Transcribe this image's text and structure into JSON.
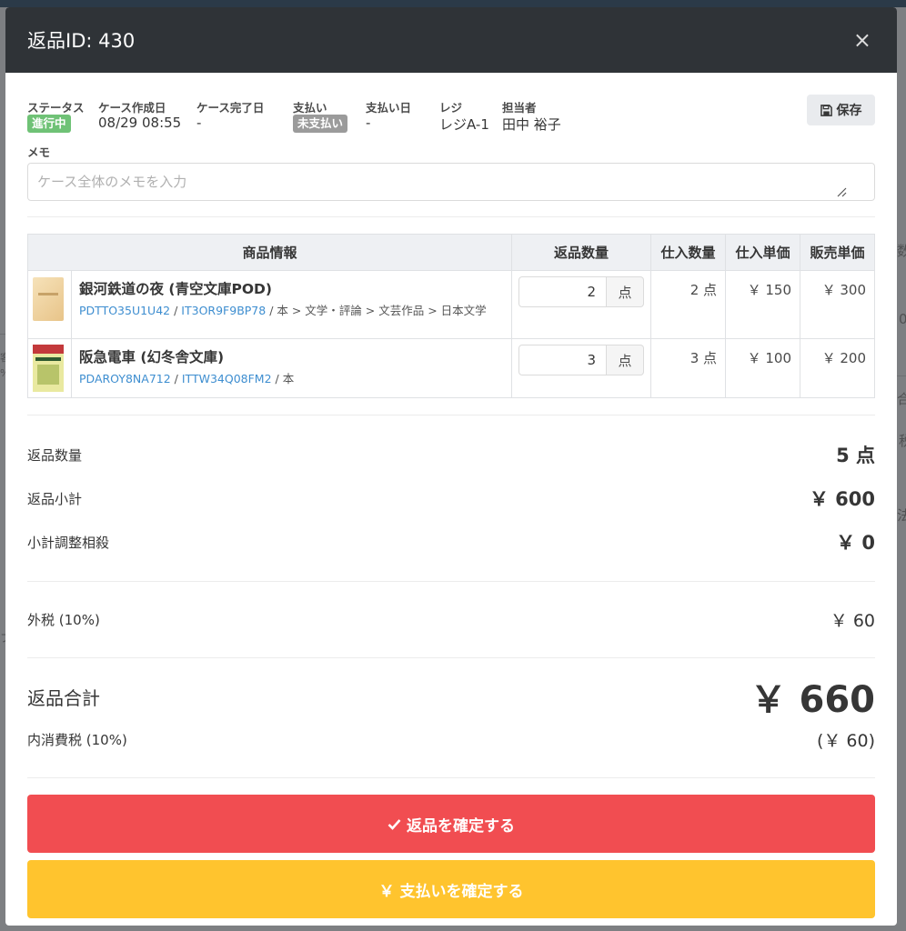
{
  "background": {
    "fragments": [
      "数",
      "0",
      "合",
      "税",
      "法",
      "客",
      "%",
      "フ"
    ]
  },
  "modal": {
    "title": "返品ID: 430",
    "close_glyph": "×"
  },
  "info": {
    "status": {
      "label": "ステータス",
      "value": "進行中"
    },
    "created": {
      "label": "ケース作成日",
      "value": "08/29 08:55"
    },
    "completed": {
      "label": "ケース完了日",
      "value": "-"
    },
    "payment": {
      "label": "支払い",
      "value": "未支払い"
    },
    "payment_date": {
      "label": "支払い日",
      "value": "-"
    },
    "register": {
      "label": "レジ",
      "value": "レジA-1"
    },
    "staff": {
      "label": "担当者",
      "value": "田中 裕子"
    },
    "save_label": "保存"
  },
  "memo": {
    "label": "メモ",
    "placeholder": "ケース全体のメモを入力",
    "value": ""
  },
  "table": {
    "headers": {
      "product": "商品情報",
      "return_qty": "返品数量",
      "purchase_qty": "仕入数量",
      "purchase_price": "仕入単価",
      "sale_price": "販売単価"
    },
    "rows": [
      {
        "title": "銀河鉄道の夜 (青空文庫POD)",
        "code1": "PDTTO35U1U42",
        "code2": "IT3OR9F9BP78",
        "category": " / 本 > 文学・評論 > 文芸作品 > 日本文学",
        "qty": "2",
        "unit": "点",
        "purchase_qty": "2 点",
        "purchase_price": "￥ 150",
        "sale_price": "￥ 300"
      },
      {
        "title": "阪急電車 (幻冬舎文庫)",
        "code1": "PDAROY8NA712",
        "code2": "ITTW34Q08FM2",
        "category": " / 本",
        "qty": "3",
        "unit": "点",
        "purchase_qty": "3 点",
        "purchase_price": "￥ 100",
        "sale_price": "￥ 200"
      }
    ]
  },
  "summary": {
    "return_qty": {
      "label": "返品数量",
      "value": "5 点"
    },
    "subtotal": {
      "label": "返品小計",
      "value": "￥ 600"
    },
    "adjustment": {
      "label": "小計調整相殺",
      "value": "￥ 0"
    },
    "tax": {
      "label": "外税 (10%)",
      "value": "￥ 60"
    },
    "total": {
      "label": "返品合計",
      "value": "￥ 660"
    },
    "inner_tax": {
      "label": "内消費税 (10%)",
      "value": "(￥ 60)"
    }
  },
  "actions": {
    "confirm_return": "返品を確定する",
    "confirm_payment": "支払いを確定する"
  },
  "colors": {
    "header_bg": "#2f3337",
    "status_green": "#6fc276",
    "payment_grey": "#9b9b9b",
    "link_blue": "#3e8ed0",
    "confirm_red": "#f14d51",
    "payment_yellow": "#ffc42e"
  }
}
